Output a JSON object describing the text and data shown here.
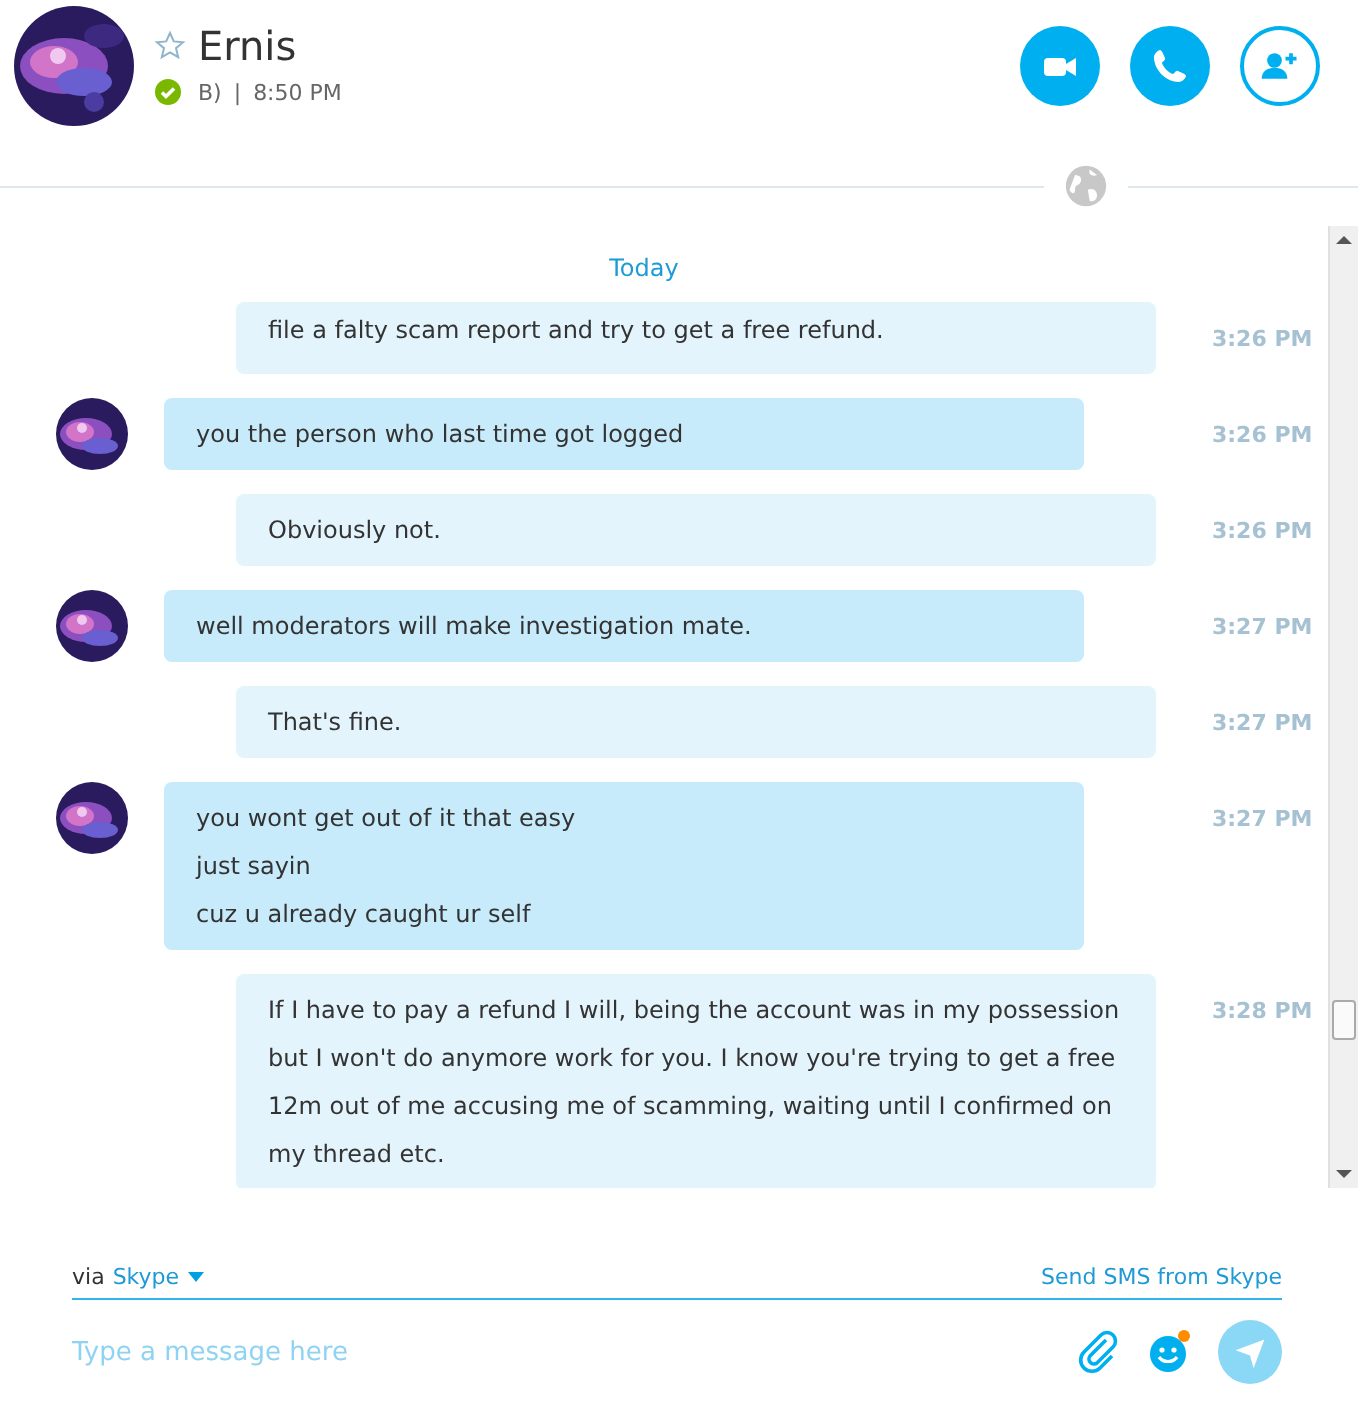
{
  "contact": {
    "name": "Ernis",
    "favorite": false,
    "online": true,
    "mood": "B)",
    "separator": "|",
    "local_time": "8:50 PM"
  },
  "date_divider": "Today",
  "messages": [
    {
      "kind": "outgoing",
      "lines": [
        "file a falty scam report and try to get a free refund."
      ],
      "time": "3:26 PM"
    },
    {
      "kind": "incoming",
      "lines": [
        "you the person who last time got logged"
      ],
      "time": "3:26 PM"
    },
    {
      "kind": "outgoing",
      "lines": [
        "Obviously not."
      ],
      "time": "3:26 PM"
    },
    {
      "kind": "incoming",
      "lines": [
        "well moderators will make investigation mate."
      ],
      "time": "3:27 PM"
    },
    {
      "kind": "outgoing",
      "lines": [
        "That's fine."
      ],
      "time": "3:27 PM"
    },
    {
      "kind": "incoming",
      "lines": [
        "you wont get out of it that easy",
        "just sayin",
        "cuz u already caught ur self"
      ],
      "time": "3:27 PM"
    },
    {
      "kind": "outgoing",
      "lines": [
        "If I have to pay a refund I will, being the account was in my possession but I won't do anymore work for you. I know you're trying to get a free 12m out of me accusing me of scamming, waiting until I confirmed on my thread etc."
      ],
      "time": "3:28 PM"
    }
  ],
  "compose": {
    "via_label": "via",
    "via_service": "Skype",
    "sms_link": "Send SMS from Skype",
    "placeholder": "Type a message here",
    "emoji_notification": true
  }
}
